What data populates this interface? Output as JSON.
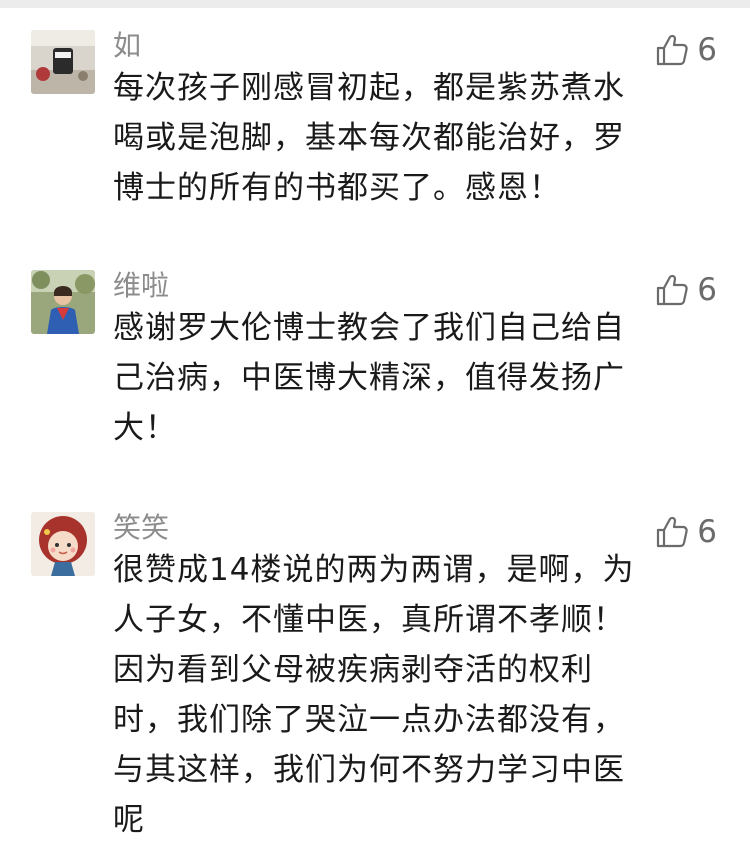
{
  "comments": [
    {
      "nickname": "如",
      "like_count": "6",
      "content": "每次孩子刚感冒初起，都是紫苏煮水\n喝或是泡脚，基本每次都能治好，罗\n博士的所有的书都买了。感恩！"
    },
    {
      "nickname": "维啦",
      "like_count": "6",
      "content": "感谢罗大伦博士教会了我们自己给自\n己治病，中医博大精深，值得发扬广\n大！"
    },
    {
      "nickname": "笑笑",
      "like_count": "6",
      "content": "很赞成14楼说的两为两谓，是啊，为\n人子女，不懂中医，真所谓不孝顺！\n因为看到父母被疾病剥夺活的权利\n时，我们除了哭泣一点办法都没有，\n与其这样，我们为何不努力学习中医\n呢"
    }
  ],
  "icons": {
    "like": "thumbs-up-outline-icon"
  },
  "colors": {
    "nickname": "#8c8c8c",
    "content": "#1a1a1a",
    "like": "#6b6b6b"
  }
}
